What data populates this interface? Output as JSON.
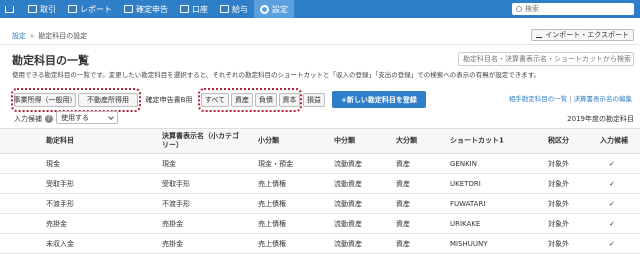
{
  "nav": {
    "items": [
      {
        "label": "取引"
      },
      {
        "label": "レポート"
      },
      {
        "label": "確定申告"
      },
      {
        "label": "口座"
      },
      {
        "label": "給与"
      },
      {
        "label": "設定"
      }
    ],
    "search_placeholder": "検索"
  },
  "breadcrumb": {
    "root": "設定",
    "current": "勘定科目の設定"
  },
  "import_export_label": "インポート・エクスポート",
  "page_title": "勘定科目の一覧",
  "filter_placeholder": "勘定科目名・決算書表示名・ショートカットから検索",
  "description": "使用できる勘定科目の一覧です。変更したい勘定科目を選択すると、それぞれの勘定科目のショートカットと「収入の登録」「支出の登録」での検索への表示の有無が設定できます。",
  "tabs_income": [
    "事業所得（一般用）",
    "不動産所得用"
  ],
  "tab_misc": "確定申告書B用",
  "tabs_category": [
    "すべて",
    "資産",
    "負債",
    "資本"
  ],
  "tab_extra": "損益",
  "add_button": "+新しい勘定科目を登録",
  "sort_links": [
    "相手勘定科目の一覧",
    "決算書表示名の編集"
  ],
  "input_candidate": {
    "label": "入力候補",
    "help": "?",
    "value": "使用する"
  },
  "year_label": "2019年度の勘定科目",
  "table": {
    "headers": [
      "勘定科目",
      "決算書表示名（小カテゴリー）",
      "小分類",
      "中分類",
      "大分類",
      "ショートカット1",
      "税区分",
      "入力候補"
    ],
    "rows": [
      [
        "現金",
        "現金",
        "現金・預金",
        "流動資産",
        "資産",
        "GENKIN",
        "対象外",
        "✓"
      ],
      [
        "受取手形",
        "受取手形",
        "売上債権",
        "流動資産",
        "資産",
        "UKETORI",
        "対象外",
        "✓"
      ],
      [
        "不渡手形",
        "不渡手形",
        "売上債権",
        "流動資産",
        "資産",
        "FUWATARI",
        "対象外",
        "✓"
      ],
      [
        "売掛金",
        "売掛金",
        "売上債権",
        "流動資産",
        "資産",
        "URIKAKE",
        "対象外",
        "✓"
      ],
      [
        "未収入金",
        "売掛金",
        "売上債権",
        "流動資産",
        "資産",
        "MISHUUNY",
        "対象外",
        "✓"
      ]
    ]
  },
  "colors": {
    "brand": "#2f7fc8",
    "highlight": "#b3203a"
  }
}
